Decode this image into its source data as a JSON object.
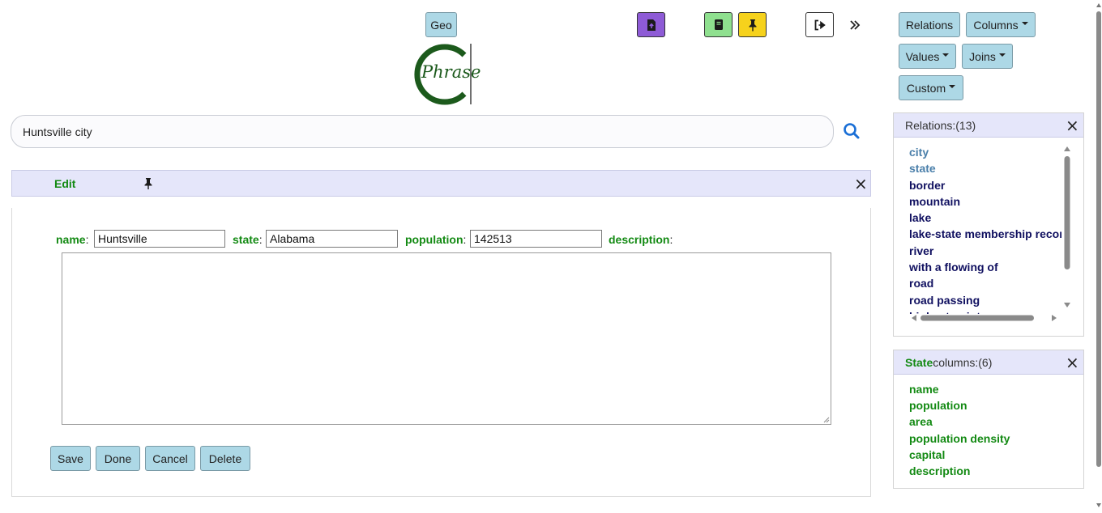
{
  "toolbar": {
    "geo_label": "Geo",
    "logo_letter": "C",
    "logo_word": "Phrase"
  },
  "search": {
    "value": "Huntsville city"
  },
  "edit_panel": {
    "title": "Edit",
    "fields": [
      {
        "label": "name",
        "value": "Huntsville"
      },
      {
        "label": "state",
        "value": "Alabama"
      },
      {
        "label": "population",
        "value": "142513"
      },
      {
        "label": "description",
        "value": ""
      }
    ],
    "buttons": [
      "Save",
      "Done",
      "Cancel",
      "Delete"
    ]
  },
  "right_toolbar": {
    "relations": "Relations",
    "columns": "Columns",
    "values": "Values",
    "joins": "Joins",
    "custom": "Custom"
  },
  "relations_panel": {
    "title": "Relations:(13)",
    "items": [
      {
        "label": "city",
        "color": "#4a7faa"
      },
      {
        "label": "state",
        "color": "#4a7faa"
      },
      {
        "label": "border",
        "color": "#101060"
      },
      {
        "label": "mountain",
        "color": "#101060"
      },
      {
        "label": "lake",
        "color": "#101060"
      },
      {
        "label": "lake-state membership record",
        "color": "#101060"
      },
      {
        "label": "river",
        "color": "#101060"
      },
      {
        "label": "with a flowing of",
        "color": "#101060"
      },
      {
        "label": "road",
        "color": "#101060"
      },
      {
        "label": "road passing",
        "color": "#101060"
      },
      {
        "label": "highest point",
        "color": "#101060"
      }
    ]
  },
  "columns_panel": {
    "title_entity": "State",
    "title_rest": " columns:(6)",
    "items": [
      "name",
      "population",
      "area",
      "population density",
      "capital",
      "description"
    ]
  },
  "colors": {
    "button_light_blue": "#add8e6",
    "upload_purple": "#8e5bd6",
    "book_green": "#8fe08f",
    "pin_yellow": "#f6d21c",
    "label_green": "#138a13",
    "edit_header_bg": "#e5e6fa",
    "search_blue": "#1a6fd6"
  }
}
